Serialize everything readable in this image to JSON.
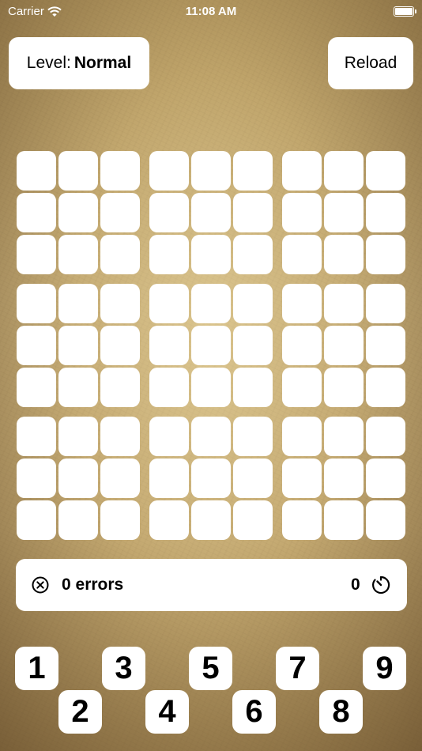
{
  "status_bar": {
    "carrier": "Carrier",
    "time": "11:08 AM"
  },
  "header": {
    "level_prefix": "Level:",
    "level_value": "Normal",
    "reload_label": "Reload"
  },
  "board": {
    "cells": [
      [
        "",
        "",
        "",
        "",
        "",
        "",
        "",
        "",
        ""
      ],
      [
        "",
        "",
        "",
        "",
        "",
        "",
        "",
        "",
        ""
      ],
      [
        "",
        "",
        "",
        "",
        "",
        "",
        "",
        "",
        ""
      ],
      [
        "",
        "",
        "",
        "",
        "",
        "",
        "",
        "",
        ""
      ],
      [
        "",
        "",
        "",
        "",
        "",
        "",
        "",
        "",
        ""
      ],
      [
        "",
        "",
        "",
        "",
        "",
        "",
        "",
        "",
        ""
      ],
      [
        "",
        "",
        "",
        "",
        "",
        "",
        "",
        "",
        ""
      ],
      [
        "",
        "",
        "",
        "",
        "",
        "",
        "",
        "",
        ""
      ],
      [
        "",
        "",
        "",
        "",
        "",
        "",
        "",
        "",
        ""
      ]
    ]
  },
  "status": {
    "errors_text": "0 errors",
    "timer_value": "0",
    "errors_icon": "close-circle-icon",
    "timer_icon": "stopwatch-icon"
  },
  "number_pad": {
    "numbers": [
      "1",
      "2",
      "3",
      "4",
      "5",
      "6",
      "7",
      "8",
      "9"
    ]
  }
}
